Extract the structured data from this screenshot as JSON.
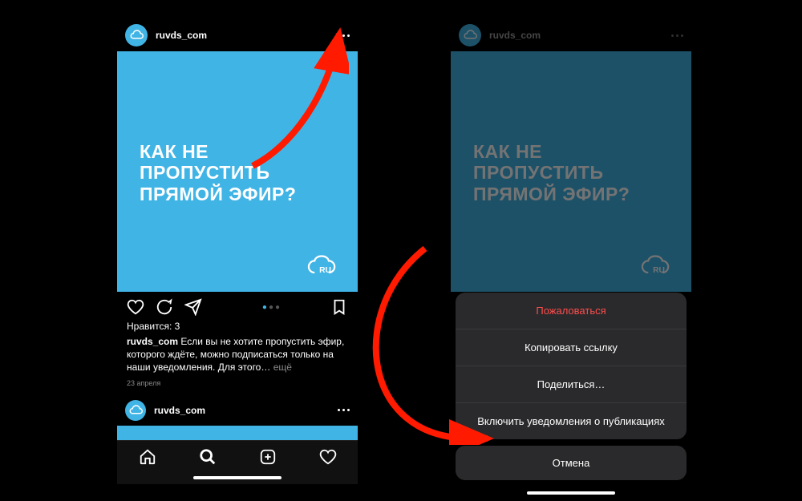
{
  "left": {
    "username": "ruvds_com",
    "headline": "КАК НЕ\nПРОПУСТИТЬ\nПРЯМОЙ ЭФИР?",
    "likes_label": "Нравится:",
    "likes_count": "3",
    "caption_user": "ruvds_com",
    "caption_text": "Если вы не хотите пропустить эфир, которого ждёте, можно подписаться только на наши уведомления. Для этого…",
    "caption_more": "ещё",
    "date": "23 апреля",
    "next_username": "ruvds_com"
  },
  "right": {
    "username": "ruvds_com",
    "headline": "КАК НЕ\nПРОПУСТИТЬ\nПРЯМОЙ ЭФИР?"
  },
  "sheet": {
    "report": "Пожаловаться",
    "copy": "Копировать ссылку",
    "share": "Поделиться…",
    "notify": "Включить уведомления о публикациях",
    "cancel": "Отмена"
  },
  "colors": {
    "brand": "#41b4e6",
    "danger": "#ff4d4d"
  }
}
